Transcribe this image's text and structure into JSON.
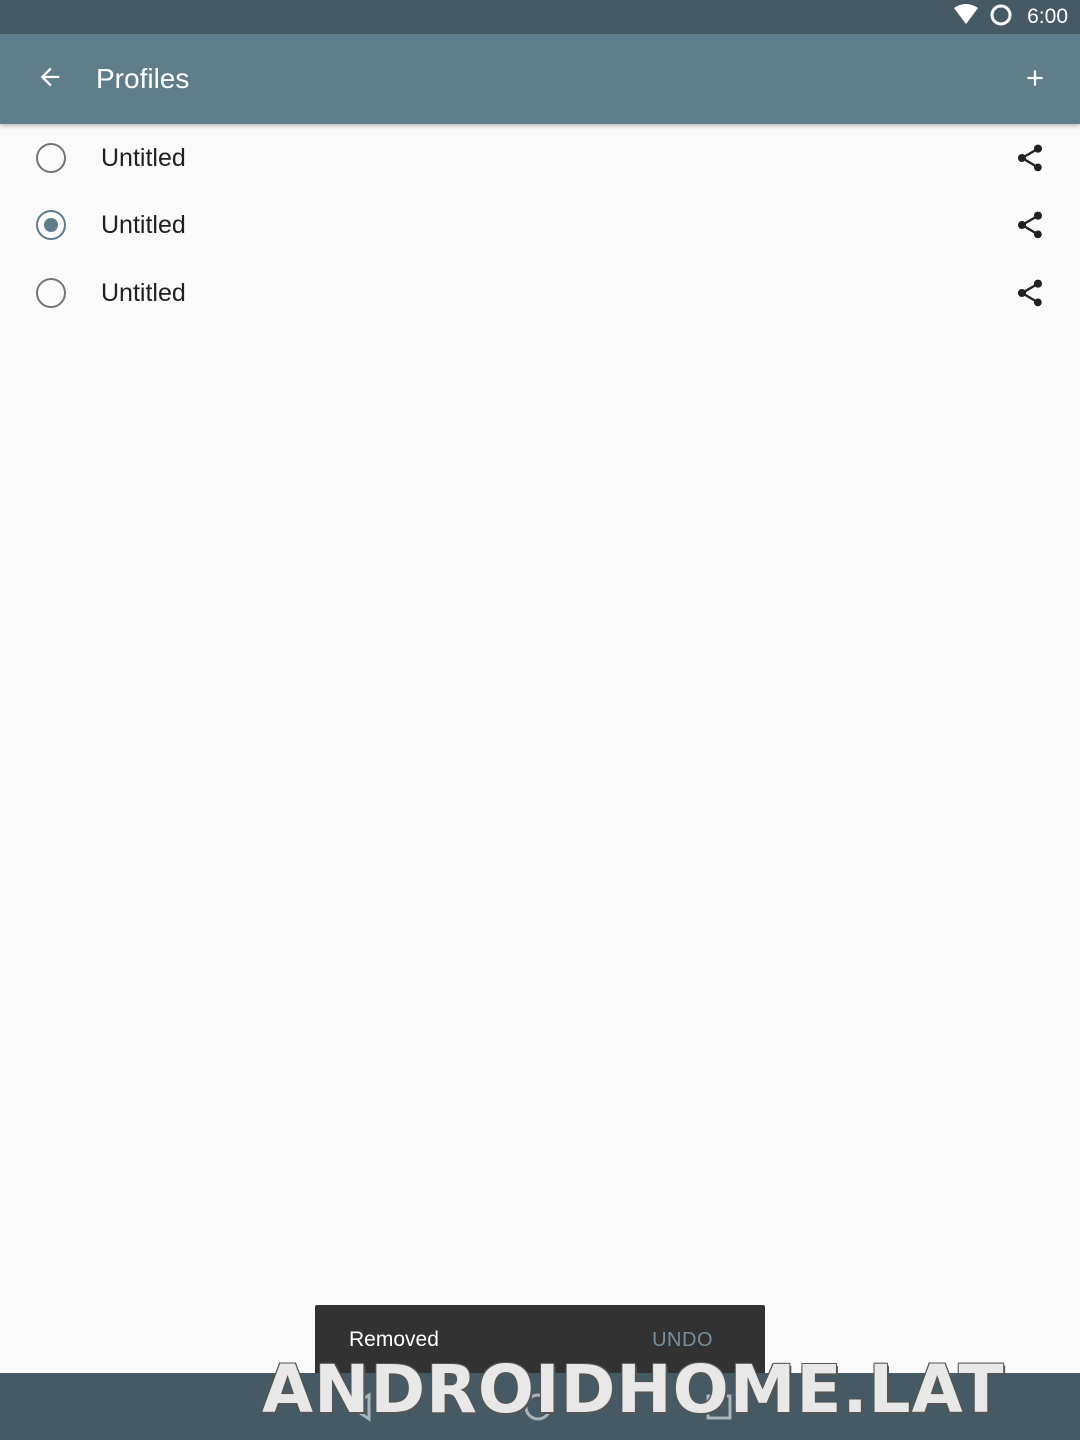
{
  "status_bar": {
    "time": "6:00",
    "icons": [
      "wifi-icon",
      "ring-icon"
    ]
  },
  "app_bar": {
    "title": "Profiles",
    "back_icon": "arrow-back-icon",
    "add_icon": "plus-icon"
  },
  "profiles": [
    {
      "label": "Untitled",
      "selected": false
    },
    {
      "label": "Untitled",
      "selected": true
    },
    {
      "label": "Untitled",
      "selected": false
    }
  ],
  "snackbar": {
    "message": "Removed",
    "action": "UNDO"
  },
  "nav_bar": {
    "buttons": [
      "back-triangle-icon",
      "home-circle-icon",
      "recents-square-icon"
    ]
  },
  "watermark": "ANDROIDHOME.LAT",
  "colors": {
    "status_bar": "#455a64",
    "app_bar": "#607d8b",
    "accent": "#607d8b",
    "snackbar": "#323232",
    "snackbar_action": "#78909c",
    "background": "#fafafa"
  }
}
